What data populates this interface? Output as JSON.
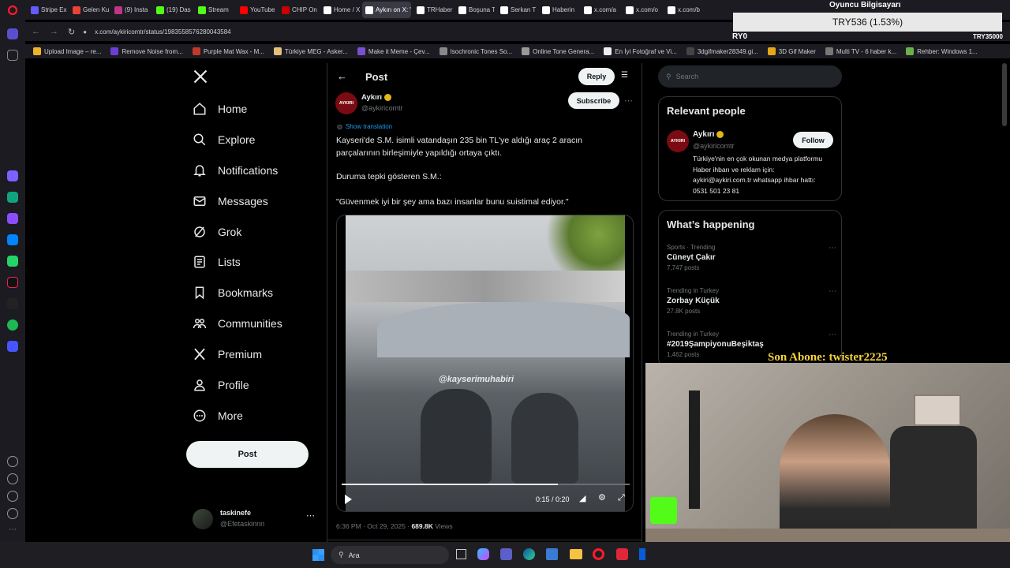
{
  "browser": {
    "tabs": [
      {
        "label": "Stripe Ex",
        "color": "#635bff"
      },
      {
        "label": "Gelen Ku",
        "color": "#ea4335"
      },
      {
        "label": "(9) Insta",
        "color": "#c13584"
      },
      {
        "label": "(19) Das",
        "color": "#53fc18"
      },
      {
        "label": "Stream",
        "color": "#53fc18"
      },
      {
        "label": "YouTube",
        "color": "#ff0000"
      },
      {
        "label": "CHIP On",
        "color": "#c00"
      },
      {
        "label": "Home / X",
        "color": "#ffffff"
      },
      {
        "label": "Aykırı on X: \"Ka",
        "color": "#ffffff"
      },
      {
        "label": "TRHaber",
        "color": "#ffffff"
      },
      {
        "label": "Boşuna T",
        "color": "#ffffff"
      },
      {
        "label": "Serkan T",
        "color": "#ffffff"
      },
      {
        "label": "Haberin",
        "color": "#ffffff"
      },
      {
        "label": "x.com/a",
        "color": "#ffffff"
      },
      {
        "label": "x.com/o",
        "color": "#ffffff"
      },
      {
        "label": "x.com/b",
        "color": "#ffffff"
      }
    ],
    "url": "x.com/aykiricomtr/status/1983558576280043584",
    "bookmarks": [
      "Upload Image – re...",
      "Remove Noise from...",
      "Purple Mat Wax - M...",
      "Türkiye MEG - Asker...",
      "Make it Meme - Çev...",
      "Isochronic Tones So...",
      "Online Tone Genera...",
      "En İyi Fotoğraf ve Vi...",
      "3dgifmaker28349.gi...",
      "3D Gif Maker",
      "Multi TV - 6 haber k...",
      "Rehber: Windows 1..."
    ]
  },
  "nav": {
    "items": [
      "Home",
      "Explore",
      "Notifications",
      "Messages",
      "Grok",
      "Lists",
      "Bookmarks",
      "Communities",
      "Premium",
      "Profile",
      "More"
    ],
    "post_label": "Post",
    "account_name": "taskinefe",
    "account_handle": "@Efetaskinnn"
  },
  "post": {
    "header_title": "Post",
    "reply_label": "Reply",
    "author_name": "Aykırı",
    "author_handle": "@aykiricomtr",
    "avatar_text": "AYKIRI",
    "subscribe_label": "Subscribe",
    "show_translation": "Show translation",
    "body_1": "Kayseri'de S.M. isimli vatandaşın 235 bin TL'ye aldığı araç 2 aracın parçalarının birleşimiyle yapıldığı ortaya çıktı.",
    "body_2": "Duruma tepki gösteren S.M.:",
    "body_3": "\"Güvenmek iyi bir şey ama bazı insanlar bunu suistimal ediyor.\"",
    "video_watermark": "@kayserimuhabiri",
    "video_time": "0:15 / 0:20",
    "video_progress": 0.75,
    "timestamp": "6:36 PM · Oct 29, 2025 · ",
    "views_count": "689.8K",
    "views_label": " Views"
  },
  "sidebar": {
    "search_placeholder": "Search",
    "relevant_title": "Relevant people",
    "person_name": "Aykırı",
    "person_handle": "@aykiricomtr",
    "follow_label": "Follow",
    "person_bio": "Türkiye'nin en çok okunan medya platformu Haber ihbarı ve reklam için: aykiri@aykiri.com.tr whatsapp ihbar hattı: 0531 501 23 81",
    "happening_title": "What’s happening",
    "trends": [
      {
        "meta": "Sports · Trending",
        "title": "Cüneyt Çakır",
        "posts": "7,747 posts"
      },
      {
        "meta": "Trending in Turkey",
        "title": "Zorbay Küçük",
        "posts": "27.8K posts"
      },
      {
        "meta": "Trending in Turkey",
        "title": "#2019ŞampiyonuBeşiktaş",
        "posts": "1,462 posts"
      }
    ]
  },
  "overlay": {
    "top_title": "Oyuncu Bilgisayarı",
    "ticker": "TRY536 (1.53%)",
    "left_tag": "RY0",
    "right_tag": "TRY35000",
    "subscriber_text": "Son Abone: twister2225"
  },
  "taskbar": {
    "search_label": "Ara"
  }
}
